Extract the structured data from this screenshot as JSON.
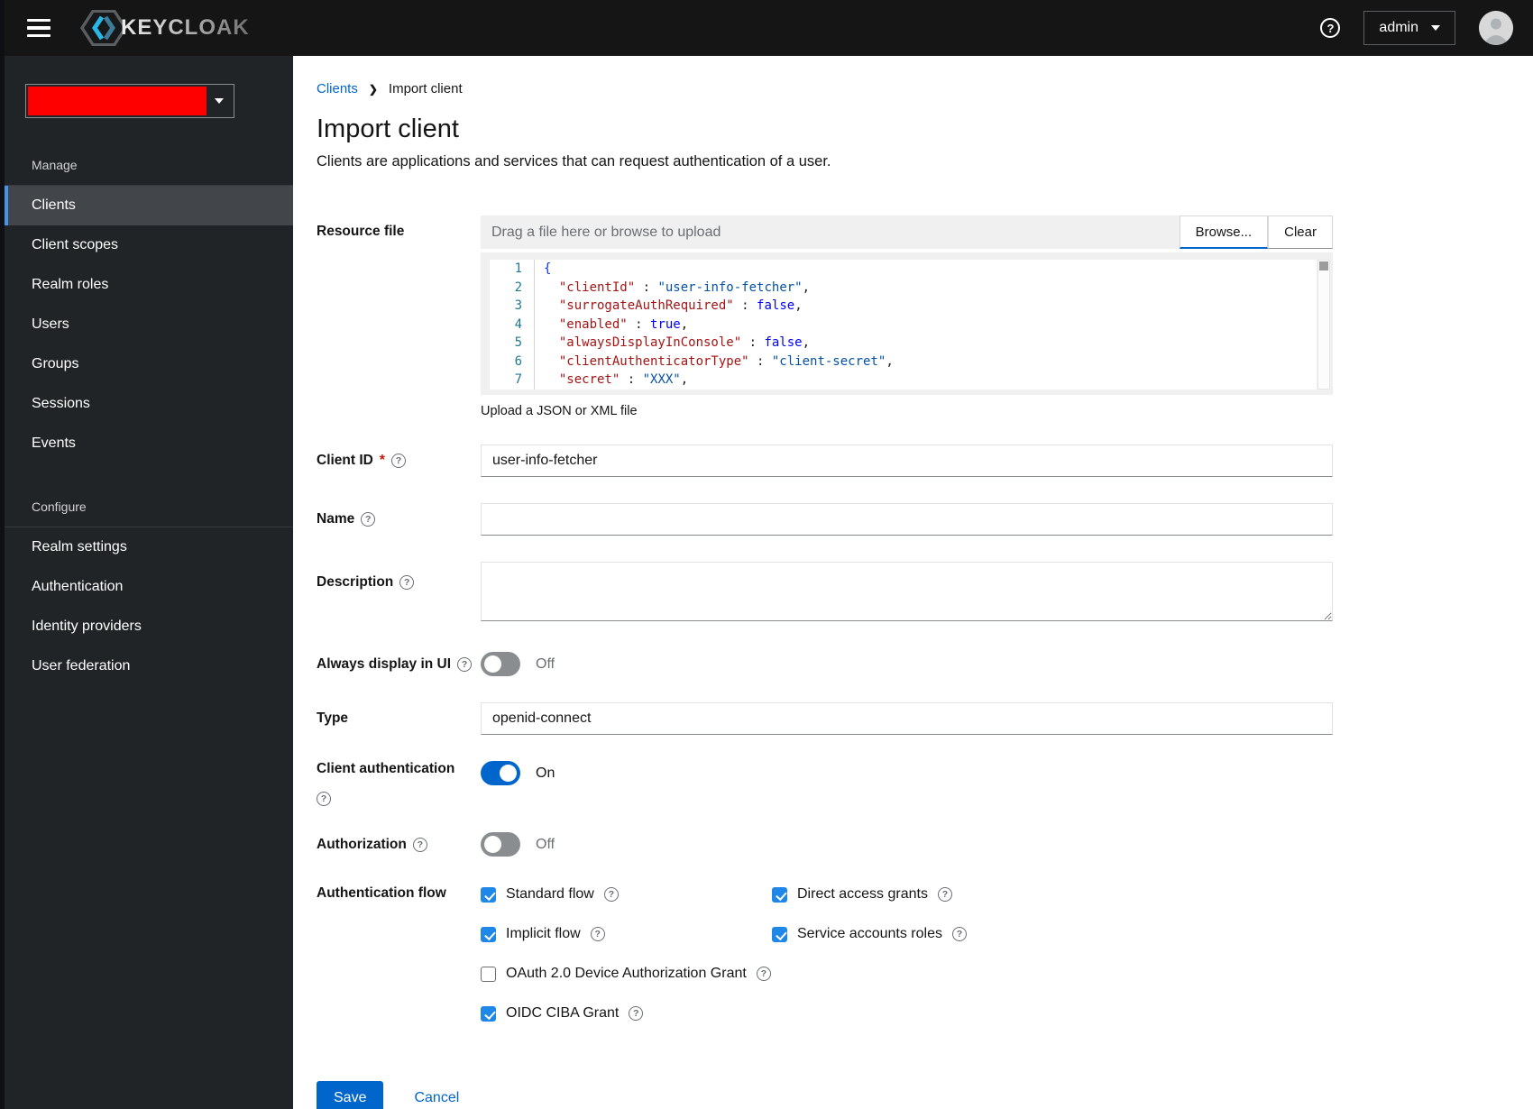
{
  "icons": {
    "help": "?",
    "required_marker": "*",
    "breadcrumb_separator": "❯"
  },
  "colors": {
    "primary": "#0066cc",
    "checkbox_checked": "#1e87e8",
    "nav_active_border": "#4296e5",
    "realm_selector_redacted": "#ff0000",
    "masthead_bg": "#151515",
    "sidebar_bg": "#212427"
  },
  "header": {
    "brand_text": "KEYCLOAK",
    "user_menu_label": "admin"
  },
  "sidebar": {
    "sections": [
      {
        "label": "Manage",
        "items": [
          {
            "label": "Clients",
            "active": true
          },
          {
            "label": "Client scopes",
            "active": false
          },
          {
            "label": "Realm roles",
            "active": false
          },
          {
            "label": "Users",
            "active": false
          },
          {
            "label": "Groups",
            "active": false
          },
          {
            "label": "Sessions",
            "active": false
          },
          {
            "label": "Events",
            "active": false
          }
        ]
      },
      {
        "label": "Configure",
        "items": [
          {
            "label": "Realm settings",
            "active": false
          },
          {
            "label": "Authentication",
            "active": false
          },
          {
            "label": "Identity providers",
            "active": false
          },
          {
            "label": "User federation",
            "active": false
          }
        ]
      }
    ]
  },
  "breadcrumb": {
    "parent": "Clients",
    "current": "Import client"
  },
  "page": {
    "title": "Import client",
    "subtitle": "Clients are applications and services that can request authentication of a user."
  },
  "form": {
    "resource_file": {
      "label": "Resource file",
      "placeholder": "Drag a file here or browse to upload",
      "browse_label": "Browse...",
      "clear_label": "Clear",
      "helper_text": "Upload a JSON or XML file",
      "code_lines": [
        {
          "num": 1,
          "tokens": [
            {
              "text": "{",
              "type": "brace"
            }
          ]
        },
        {
          "num": 2,
          "tokens": [
            {
              "text": "  ",
              "type": "plain"
            },
            {
              "text": "\"clientId\"",
              "type": "key"
            },
            {
              "text": " : ",
              "type": "plain"
            },
            {
              "text": "\"user-info-fetcher\"",
              "type": "str"
            },
            {
              "text": ",",
              "type": "plain"
            }
          ]
        },
        {
          "num": 3,
          "tokens": [
            {
              "text": "  ",
              "type": "plain"
            },
            {
              "text": "\"surrogateAuthRequired\"",
              "type": "key"
            },
            {
              "text": " : ",
              "type": "plain"
            },
            {
              "text": "false",
              "type": "bool"
            },
            {
              "text": ",",
              "type": "plain"
            }
          ]
        },
        {
          "num": 4,
          "tokens": [
            {
              "text": "  ",
              "type": "plain"
            },
            {
              "text": "\"enabled\"",
              "type": "key"
            },
            {
              "text": " : ",
              "type": "plain"
            },
            {
              "text": "true",
              "type": "bool"
            },
            {
              "text": ",",
              "type": "plain"
            }
          ]
        },
        {
          "num": 5,
          "tokens": [
            {
              "text": "  ",
              "type": "plain"
            },
            {
              "text": "\"alwaysDisplayInConsole\"",
              "type": "key"
            },
            {
              "text": " : ",
              "type": "plain"
            },
            {
              "text": "false",
              "type": "bool"
            },
            {
              "text": ",",
              "type": "plain"
            }
          ]
        },
        {
          "num": 6,
          "tokens": [
            {
              "text": "  ",
              "type": "plain"
            },
            {
              "text": "\"clientAuthenticatorType\"",
              "type": "key"
            },
            {
              "text": " : ",
              "type": "plain"
            },
            {
              "text": "\"client-secret\"",
              "type": "str"
            },
            {
              "text": ",",
              "type": "plain"
            }
          ]
        },
        {
          "num": 7,
          "tokens": [
            {
              "text": "  ",
              "type": "plain"
            },
            {
              "text": "\"secret\"",
              "type": "key"
            },
            {
              "text": " : ",
              "type": "plain"
            },
            {
              "text": "\"XXX\"",
              "type": "str"
            },
            {
              "text": ",",
              "type": "plain"
            }
          ]
        }
      ]
    },
    "client_id": {
      "label": "Client ID",
      "required": true,
      "value": "user-info-fetcher"
    },
    "name": {
      "label": "Name",
      "value": ""
    },
    "description": {
      "label": "Description",
      "value": ""
    },
    "always_display_in_ui": {
      "label": "Always display in UI",
      "state_label": "Off",
      "on": false
    },
    "type": {
      "label": "Type",
      "value": "openid-connect"
    },
    "client_authentication": {
      "label": "Client authentication",
      "state_label": "On",
      "on": true
    },
    "authorization": {
      "label": "Authorization",
      "state_label": "Off",
      "on": false
    },
    "authentication_flow": {
      "label": "Authentication flow",
      "columns": [
        [
          {
            "label": "Standard flow",
            "checked": true
          },
          {
            "label": "Implicit flow",
            "checked": true
          },
          {
            "label": "OAuth 2.0 Device Authorization Grant",
            "checked": false
          },
          {
            "label": "OIDC CIBA Grant",
            "checked": true
          }
        ],
        [
          {
            "label": "Direct access grants",
            "checked": true
          },
          {
            "label": "Service accounts roles",
            "checked": true
          }
        ]
      ]
    },
    "actions": {
      "save_label": "Save",
      "cancel_label": "Cancel"
    }
  }
}
